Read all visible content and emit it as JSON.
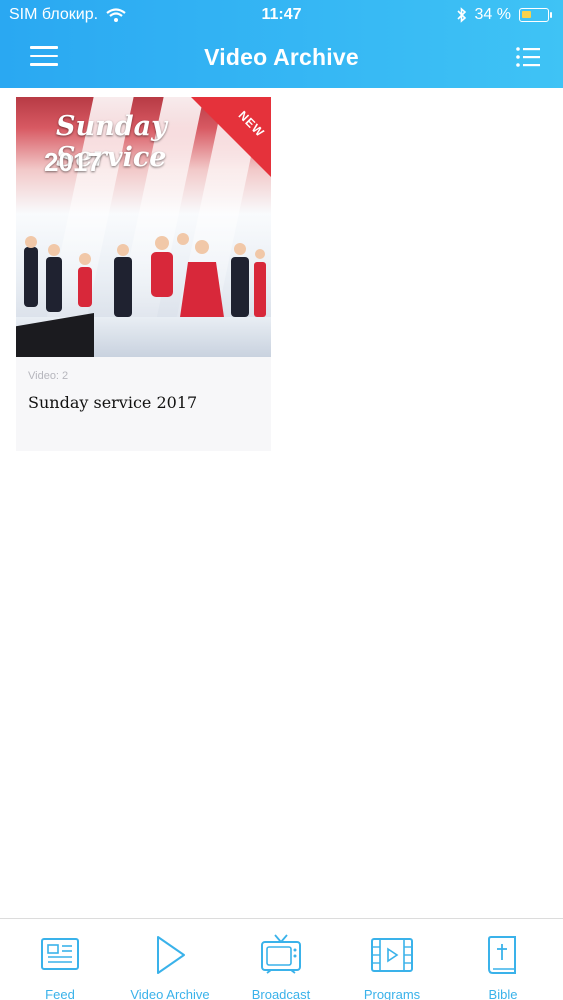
{
  "status_bar": {
    "carrier": "SIM блокир.",
    "time": "11:47",
    "battery": "34 %"
  },
  "header": {
    "title": "Video Archive",
    "menu_icon": "hamburger-menu-icon",
    "list_icon": "list-view-icon"
  },
  "content": {
    "items": [
      {
        "thumbnail_title": "Sunday Service",
        "thumbnail_year": "2017",
        "badge": "NEW",
        "meta": "Video: 2",
        "title": "Sunday service 2017"
      }
    ]
  },
  "tabbar": {
    "tabs": [
      {
        "label": "Feed",
        "icon": "newspaper-icon"
      },
      {
        "label": "Video Archive",
        "icon": "play-icon"
      },
      {
        "label": "Broadcast",
        "icon": "tv-icon"
      },
      {
        "label": "Programs",
        "icon": "film-icon"
      },
      {
        "label": "Bible",
        "icon": "bible-icon"
      }
    ]
  },
  "colors": {
    "header_start": "#2aa8f2",
    "header_end": "#3fc3f5",
    "accent": "#3ab2ea",
    "badge": "#e5323b"
  }
}
